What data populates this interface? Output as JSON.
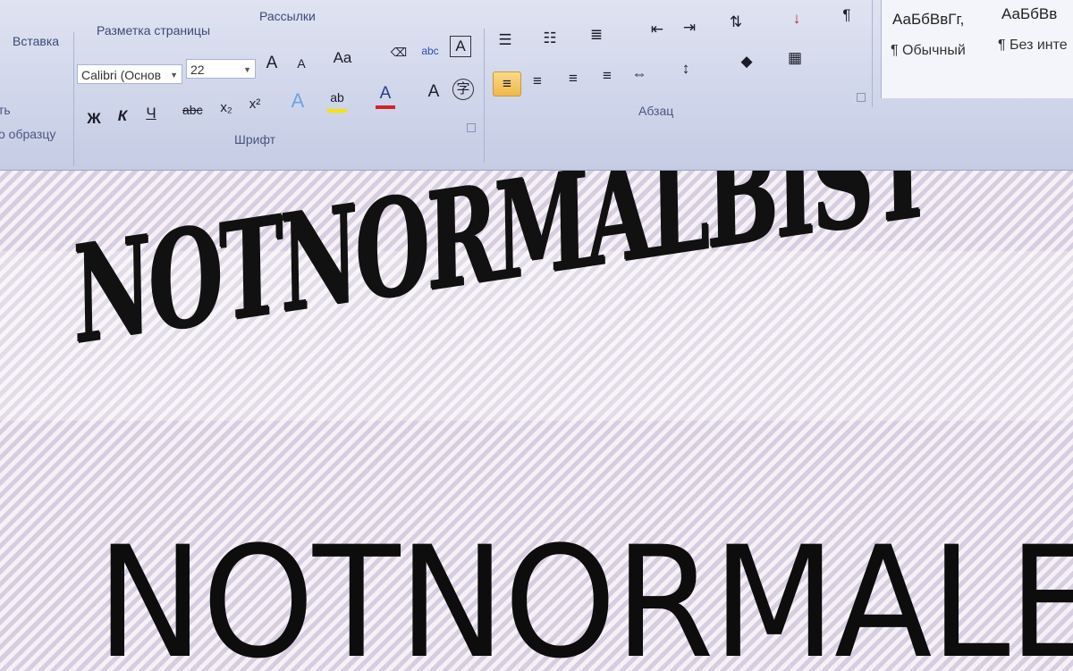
{
  "tabs": [
    "Вставка",
    "Разметка страницы",
    "Рассылки"
  ],
  "clipboard": {
    "format_painter_label": "о образцу",
    "left_label": "ть"
  },
  "font": {
    "name_value": "Calibri (Основ",
    "size_value": "22",
    "grow_label": "A",
    "shrink_label": "A",
    "case_label": "Aa",
    "bold_label": "Ж",
    "italic_label": "К",
    "underline_label": "Ч",
    "strike_label": "abc",
    "subscript_label": "x₂",
    "superscript_label": "x²",
    "effects_label": "A",
    "highlight_label": "ab",
    "color_label": "A",
    "charshade_label": "A",
    "enclose_label": "字",
    "group_label": "Шрифт"
  },
  "paragraph": {
    "group_label": "Абзац"
  },
  "styles": {
    "samples": [
      "АаБбВвГг,",
      "АаБбВв"
    ],
    "names": [
      "¶ Обычный",
      "¶ Без инте"
    ]
  },
  "document": {
    "line1": "NOTNORMALBIST",
    "line2": "NOTNORMALE"
  },
  "colors": {
    "ribbon": "#cfd5ea",
    "font_color_bar": "#d2232a",
    "highlight_bar": "#f5e300"
  }
}
